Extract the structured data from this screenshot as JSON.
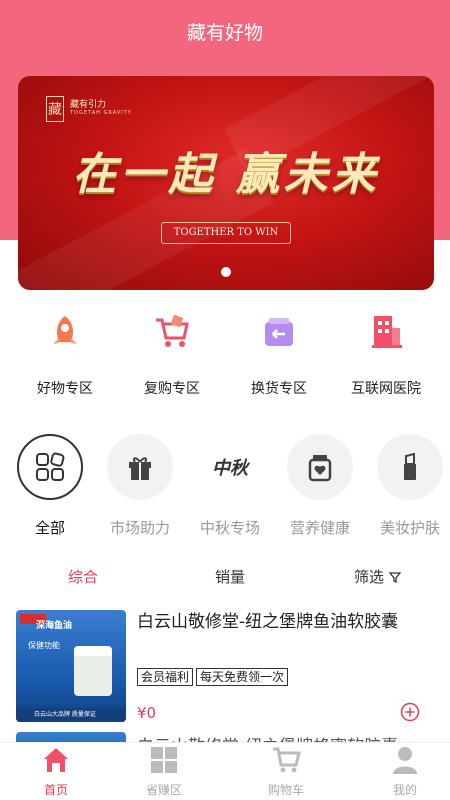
{
  "header": {
    "title": "藏有好物"
  },
  "banner": {
    "brand_mark": "藏",
    "brand_name": "藏有引力",
    "brand_sub": "TOGETAH GRAVITY",
    "slogan": "在一起 赢未来",
    "slogan_en": "TOGETHER TO WIN"
  },
  "quick_entries": [
    {
      "label": "好物专区",
      "icon": "rocket-icon"
    },
    {
      "label": "复购专区",
      "icon": "cart-icon"
    },
    {
      "label": "换货专区",
      "icon": "exchange-box-icon"
    },
    {
      "label": "互联网医院",
      "icon": "building-icon"
    }
  ],
  "categories": [
    {
      "label": "全部",
      "icon": "grid-icon",
      "active": true
    },
    {
      "label": "市场助力",
      "icon": "gift-icon"
    },
    {
      "label": "中秋专场",
      "icon": "mid-autumn-calligraphy-icon",
      "glyph": "中秋"
    },
    {
      "label": "营养健康",
      "icon": "jar-heart-icon"
    },
    {
      "label": "美妆护肤",
      "icon": "lipstick-icon"
    }
  ],
  "sort": {
    "comprehensive": "综合",
    "sales": "销量",
    "filter": "筛选"
  },
  "products": [
    {
      "title": "白云山敬修堂-纽之堡牌鱼油软胶囊",
      "tags": [
        "会员福利",
        "每天免费领一次"
      ],
      "price": "¥0",
      "image_text": {
        "head": "深海鱼油",
        "band": "保健功能",
        "foot": "白云山大品牌 质量保证"
      }
    },
    {
      "title": "白云山敬修堂-纽之堡牌蜂蜜软胶囊"
    }
  ],
  "tabbar": [
    {
      "label": "首页",
      "icon": "home-icon",
      "active": true
    },
    {
      "label": "省赚区",
      "icon": "grid-tiles-icon"
    },
    {
      "label": "购物车",
      "icon": "shopping-cart-icon"
    },
    {
      "label": "我的",
      "icon": "person-icon"
    }
  ],
  "colors": {
    "accent": "#e83b52",
    "header_bg": "#f2677d",
    "banner_red": "#c31414"
  }
}
